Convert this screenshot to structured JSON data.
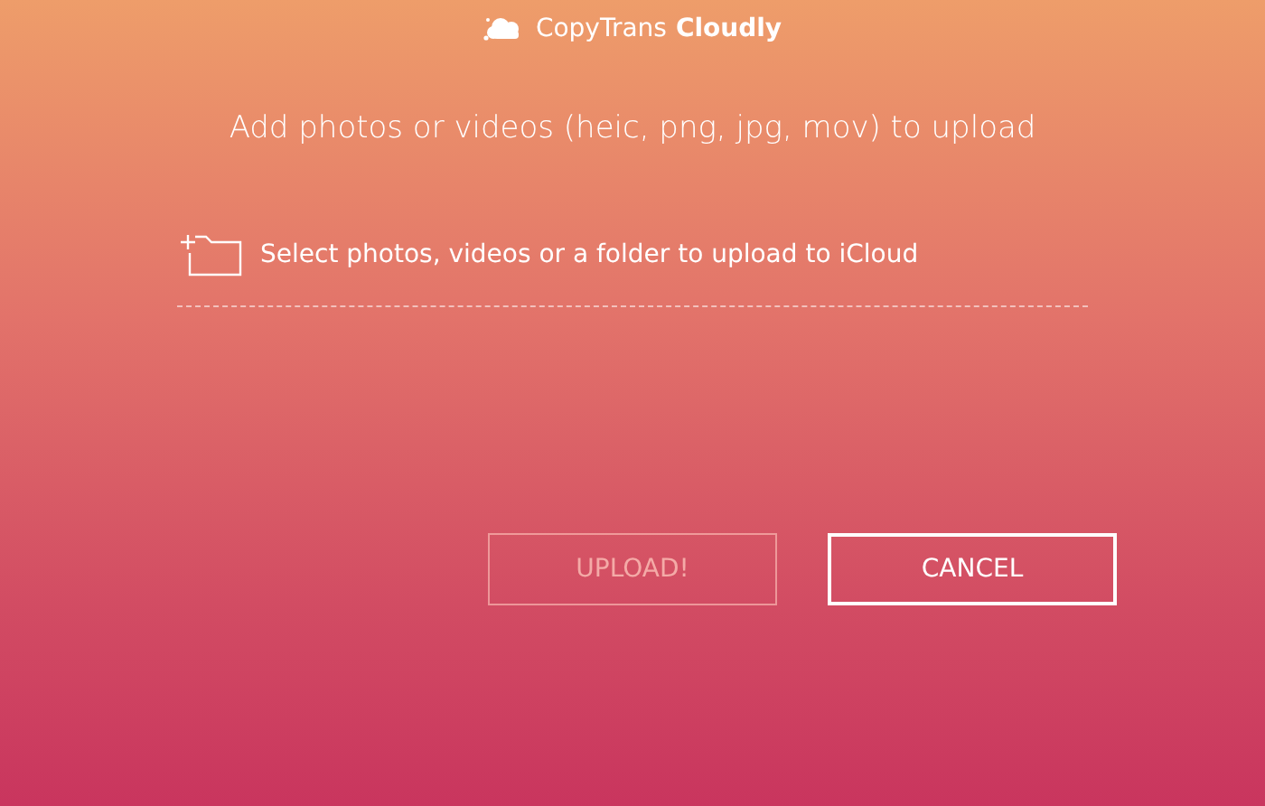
{
  "logo": {
    "brand": "CopyTrans",
    "product": "Cloudly"
  },
  "heading": "Add photos or videos (heic, png, jpg, mov) to upload",
  "picker": {
    "placeholder": "Select photos, videos or a folder to upload to iCloud"
  },
  "buttons": [
    {
      "label": "UPLOAD!",
      "disabled": true
    },
    {
      "label": "CANCEL",
      "disabled": false
    }
  ]
}
